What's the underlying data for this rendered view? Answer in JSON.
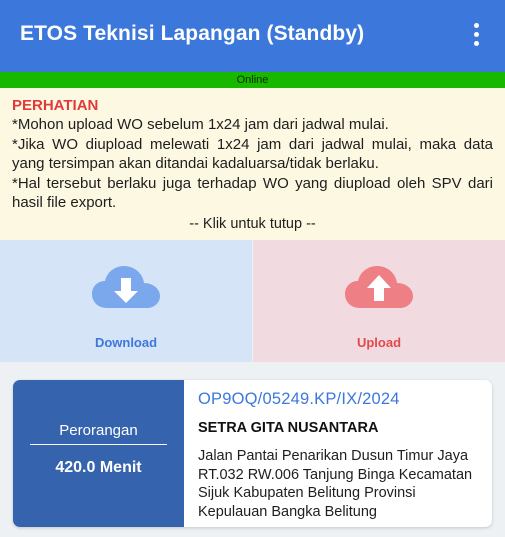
{
  "app": {
    "title": "ETOS Teknisi Lapangan (Standby)",
    "status": "Online",
    "colors": {
      "appbar": "#3c78dc",
      "status": "#18b800",
      "download": "#3c78dc",
      "upload": "#e24a4a"
    }
  },
  "notice": {
    "heading": "PERHATIAN",
    "lines": [
      "*Mohon upload WO sebelum 1x24 jam dari jadwal mulai.",
      "*Jika WO diupload melewati 1x24 jam dari jadwal mulai, maka data yang tersimpan akan ditandai kadaluarsa/tidak berlaku.",
      "*Hal tersebut berlaku juga terhadap WO yang diupload oleh SPV dari hasil file export."
    ],
    "close_text": "-- Klik untuk tutup --"
  },
  "actions": {
    "download": {
      "label": "Download",
      "icon": "cloud-download-icon"
    },
    "upload": {
      "label": "Upload",
      "icon": "cloud-upload-icon"
    }
  },
  "work_orders": [
    {
      "type": "Perorangan",
      "duration": "420.0 Menit",
      "wo_number": "OP9OQ/05249.KP/IX/2024",
      "customer": "SETRA GITA NUSANTARA",
      "address": "Jalan Pantai Penarikan Dusun Timur Jaya RT.032 RW.006  Tanjung Binga Kecamatan Sijuk Kabupaten Belitung Provinsi Kepulauan Bangka Belitung"
    }
  ]
}
